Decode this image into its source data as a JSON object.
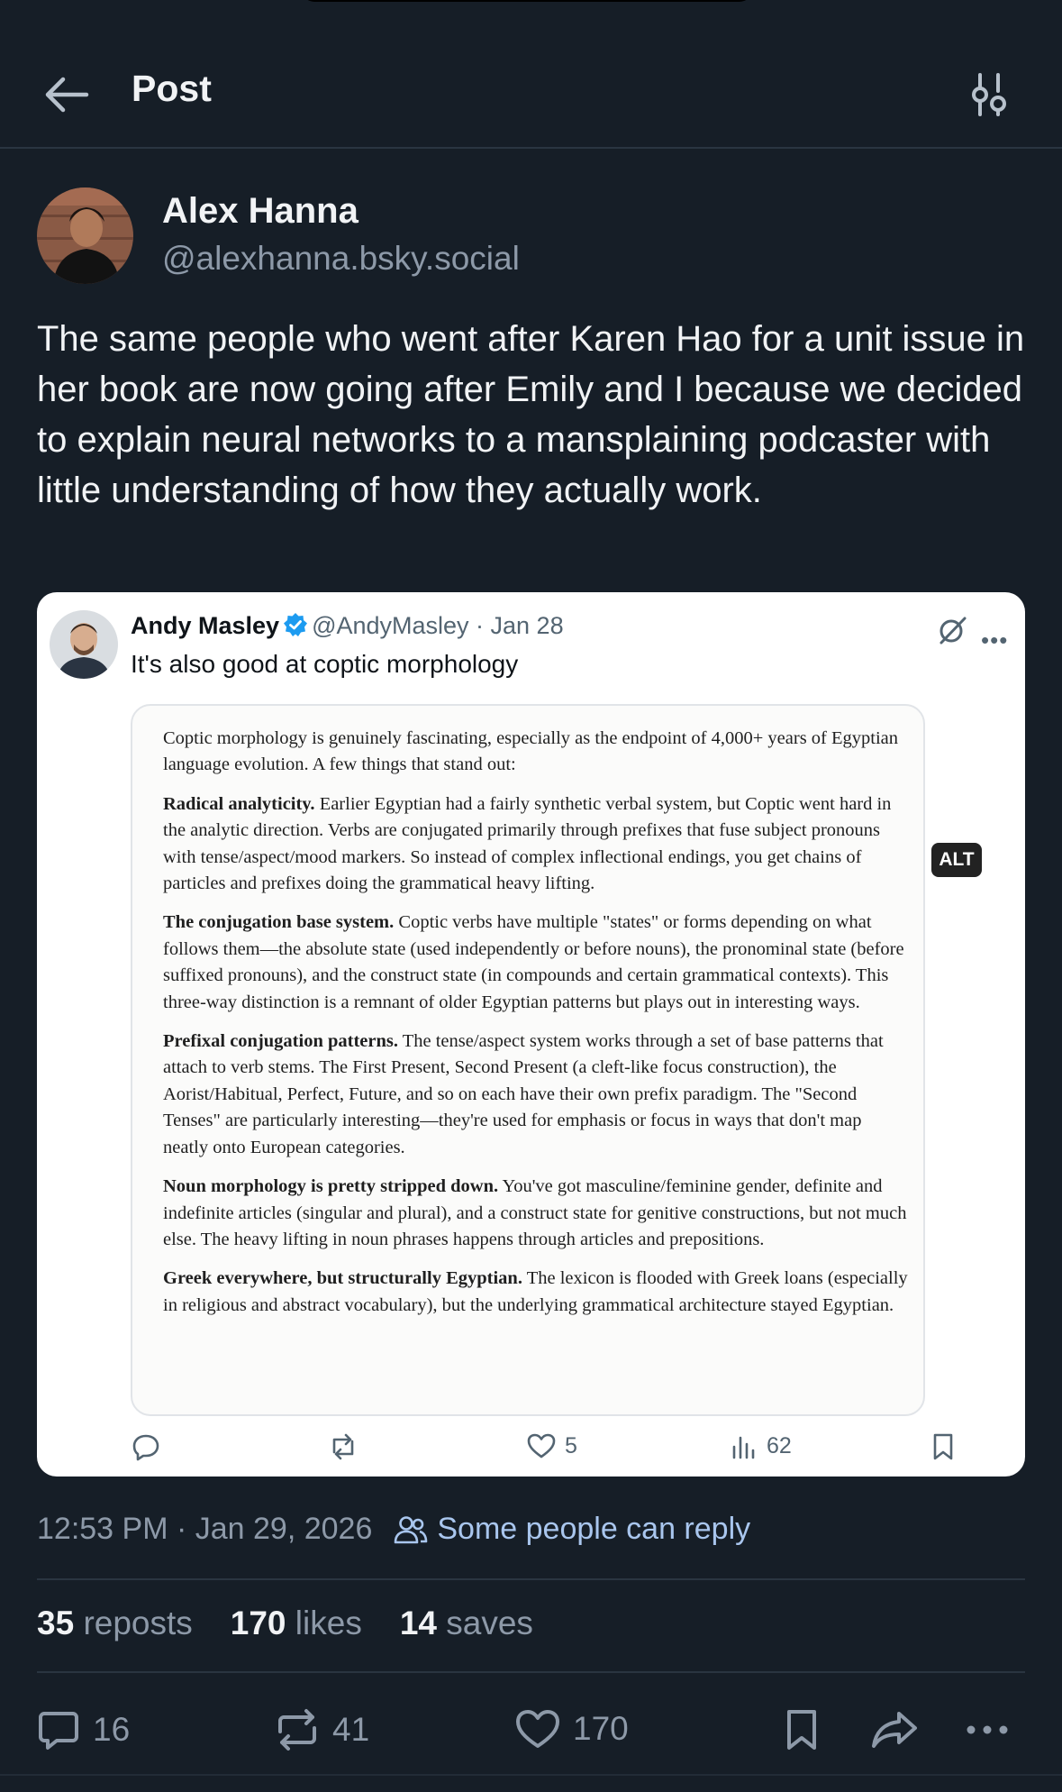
{
  "header": {
    "title": "Post"
  },
  "author": {
    "name": "Alex Hanna",
    "handle": "@alexhanna.bsky.social"
  },
  "post": {
    "text": "The same people who went after Karen Hao for a unit issue in her book are now going after Emily and I because we decided to explain neural networks to a mansplaining podcaster with little understanding of how they actually work.",
    "timestamp": "12:53 PM · Jan 29, 2026",
    "reply_setting": "Some people can reply"
  },
  "embed": {
    "name": "Andy Masley",
    "handle_date": "@AndyMasley · Jan 28",
    "text": "It's also good at coptic morphology",
    "answer": {
      "intro": "Coptic morphology is genuinely fascinating, especially as the endpoint of 4,000+ years of Egyptian language evolution. A few things that stand out:",
      "sections": [
        {
          "heading": "Radical analyticity.",
          "body": " Earlier Egyptian had a fairly synthetic verbal system, but Coptic went hard in the analytic direction. Verbs are conjugated primarily through prefixes that fuse subject pronouns with tense/aspect/mood markers. So instead of complex inflectional endings, you get chains of particles and prefixes doing the grammatical heavy lifting."
        },
        {
          "heading": "The conjugation base system.",
          "body": " Coptic verbs have multiple \"states\" or forms depending on what follows them—the absolute state (used independently or before nouns), the pronominal state (before suffixed pronouns), and the construct state (in compounds and certain grammatical contexts). This three-way distinction is a remnant of older Egyptian patterns but plays out in interesting ways."
        },
        {
          "heading": "Prefixal conjugation patterns.",
          "body": " The tense/aspect system works through a set of base patterns that attach to verb stems. The First Present, Second Present (a cleft-like focus construction), the Aorist/Habitual, Perfect, Future, and so on each have their own prefix paradigm. The \"Second Tenses\" are particularly interesting—they're used for emphasis or focus in ways that don't map neatly onto European categories."
        },
        {
          "heading": "Noun morphology is pretty stripped down.",
          "body": " You've got masculine/feminine gender, definite and indefinite articles (singular and plural), and a construct state for genitive constructions, but not much else. The heavy lifting in noun phrases happens through articles and prepositions."
        },
        {
          "heading": "Greek everywhere, but structurally Egyptian.",
          "body": " The lexicon is flooded with Greek loans (especially in religious and abstract vocabulary), but the underlying grammatical architecture stayed Egyptian."
        }
      ]
    },
    "likes": "5",
    "views": "62",
    "alt_label": "ALT"
  },
  "stats": {
    "reposts_count": "35",
    "reposts_label": "reposts",
    "likes_count": "170",
    "likes_label": "likes",
    "saves_count": "14",
    "saves_label": "saves"
  },
  "actions": {
    "replies": "16",
    "reposts": "41",
    "likes": "170"
  },
  "colors": {
    "background": "#161e27",
    "text": "#f1f3f5",
    "muted": "#8d99a8",
    "accent": "#a9c6ee",
    "verified": "#1d9bf0"
  },
  "icons": [
    "back-arrow-icon",
    "settings-sliders-icon",
    "verified-badge-icon",
    "grok-icon",
    "more-icon",
    "reply-icon",
    "repost-icon",
    "heart-icon",
    "views-icon",
    "bookmark-icon",
    "people-icon",
    "share-icon"
  ]
}
